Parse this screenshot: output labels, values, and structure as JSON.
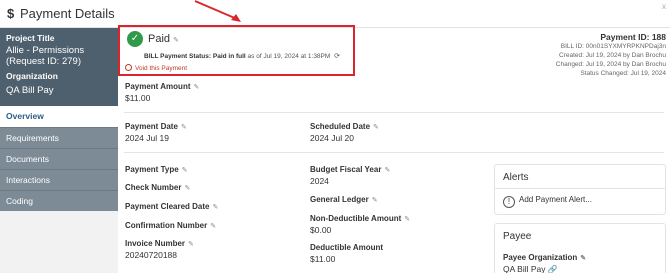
{
  "header": {
    "currency_symbol": "$",
    "title": "Payment Details",
    "close": "x"
  },
  "sidebar": {
    "project_label": "Project Title",
    "project_value": "Allie - Permissions (Request ID: 279)",
    "org_label": "Organization",
    "org_value": "QA Bill Pay",
    "nav": [
      "Overview",
      "Requirements",
      "Documents",
      "Interactions",
      "Coding"
    ]
  },
  "status": {
    "paid_label": "Paid",
    "status_prefix": "BILL Payment Status: Paid in full",
    "status_suffix": "as of Jul 19, 2024 at 1:38PM",
    "void_label": "Void this Payment"
  },
  "payment_meta": {
    "payment_id": "Payment ID: 188",
    "bill_id": "BILL ID: 00n01SYXMYRPKNPDaj3n",
    "created": "Created: Jul 19, 2024 by Dan Brochu",
    "changed": "Changed: Jul 19, 2024 by Dan Brochu",
    "status_changed": "Status Changed: Jul 19, 2024"
  },
  "fields": {
    "payment_amount": {
      "label": "Payment Amount",
      "value": "$11.00"
    },
    "payment_date": {
      "label": "Payment Date",
      "value": "2024 Jul 19"
    },
    "scheduled_date": {
      "label": "Scheduled Date",
      "value": "2024 Jul 20"
    },
    "payment_type": {
      "label": "Payment Type"
    },
    "check_number": {
      "label": "Check Number"
    },
    "payment_cleared_date": {
      "label": "Payment Cleared Date"
    },
    "confirmation_number": {
      "label": "Confirmation Number"
    },
    "invoice_number": {
      "label": "Invoice Number",
      "value": "20240720188"
    },
    "budget_fiscal_year": {
      "label": "Budget Fiscal Year",
      "value": "2024"
    },
    "general_ledger": {
      "label": "General Ledger"
    },
    "non_deductible_amount": {
      "label": "Non-Deductible Amount",
      "value": "$0.00"
    },
    "deductible_amount": {
      "label": "Deductible Amount",
      "value": "$11.00"
    }
  },
  "alerts": {
    "title": "Alerts",
    "add_label": "Add Payment Alert..."
  },
  "payee": {
    "title": "Payee",
    "org_label": "Payee Organization",
    "org_value": "QA Bill Pay"
  },
  "colors": {
    "annotation": "#d9252b",
    "paid": "#2e9a4a",
    "sidebar_dark": "#4e5f6d",
    "nav": "#7d8b96",
    "link": "#2a5d8a"
  }
}
